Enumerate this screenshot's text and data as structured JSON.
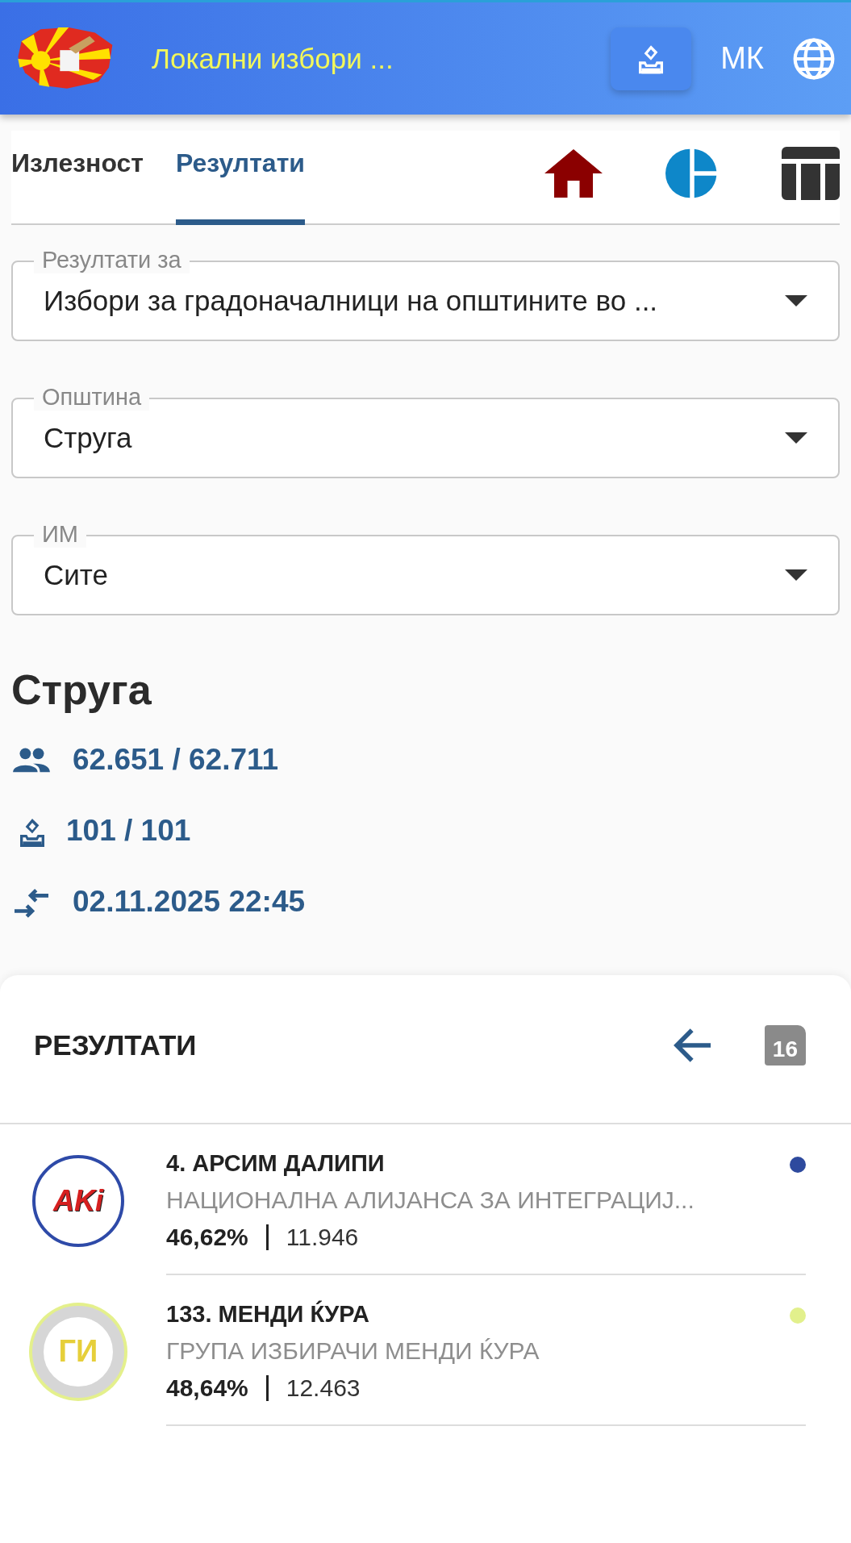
{
  "header": {
    "title": "Локални избори ...",
    "language": "МК"
  },
  "tabs": [
    {
      "label": "Излезност",
      "selected": false
    },
    {
      "label": "Резултати",
      "selected": true
    }
  ],
  "filters": [
    {
      "label": "Резултати за",
      "value": "Избори за градоначалници на општините во ..."
    },
    {
      "label": "Општина",
      "value": "Струга"
    },
    {
      "label": "ИМ",
      "value": "Сите"
    }
  ],
  "place": "Струга",
  "stats": [
    {
      "kind": "voters",
      "text": "62.651 / 62.711"
    },
    {
      "kind": "stations",
      "text": "101 / 101"
    },
    {
      "kind": "updated",
      "text": "02.11.2025 22:45"
    }
  ],
  "results": {
    "title": "РЕЗУЛТАТИ",
    "count": "16",
    "candidates": [
      {
        "name": "4. АРСИМ ДАЛИПИ",
        "party": "НАЦИОНАЛНА АЛИЈАНСА ЗА ИНТЕГРАЦИЈ...",
        "percent": "46,62%",
        "votes": "11.946",
        "color": "#2e4a9e",
        "kind": "aki",
        "logo_text": "AKi"
      },
      {
        "name": "133. МЕНДИ ЌУРА",
        "party": "ГРУПА ИЗБИРАЧИ МЕНДИ ЌУРА",
        "percent": "48,64%",
        "votes": "12.463",
        "color": "#e2f08c",
        "kind": "group",
        "logo_text": "ГИ"
      }
    ]
  }
}
